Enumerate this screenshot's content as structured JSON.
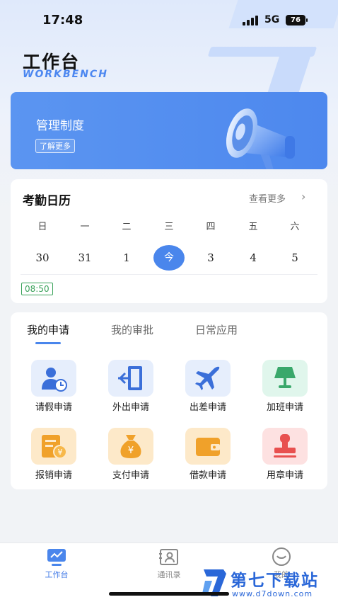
{
  "status_bar": {
    "time": "17:48",
    "network": "5G",
    "battery": "76"
  },
  "header": {
    "title": "工作台",
    "subtitle": "WORKBENCH"
  },
  "banner": {
    "title": "管理制度",
    "button_label": "了解更多",
    "icon": "megaphone-icon"
  },
  "calendar": {
    "title": "考勤日历",
    "more_label": "查看更多",
    "weekdays": [
      "日",
      "一",
      "二",
      "三",
      "四",
      "五",
      "六"
    ],
    "days": [
      "30",
      "31",
      "1",
      "今",
      "3",
      "4",
      "5"
    ],
    "today_index": 3,
    "clock_time": "08:50"
  },
  "apps": {
    "tabs": [
      {
        "label": "我的申请",
        "active": true
      },
      {
        "label": "我的审批",
        "active": false
      },
      {
        "label": "日常应用",
        "active": false
      }
    ],
    "items": [
      {
        "label": "请假申请",
        "icon": "leave-clock-icon",
        "bg": "#e6eefc",
        "color": "#3b6fd9"
      },
      {
        "label": "外出申请",
        "icon": "door-exit-icon",
        "bg": "#e6eefc",
        "color": "#3b6fd9"
      },
      {
        "label": "出差申请",
        "icon": "airplane-icon",
        "bg": "#e6eefc",
        "color": "#3b6fd9"
      },
      {
        "label": "加班申请",
        "icon": "lamp-icon",
        "bg": "#e0f6ec",
        "color": "#3aa86b"
      },
      {
        "label": "报销申请",
        "icon": "receipt-icon",
        "bg": "#fde9c9",
        "color": "#f0a12a"
      },
      {
        "label": "支付申请",
        "icon": "money-bag-icon",
        "bg": "#fde9c9",
        "color": "#f0a12a"
      },
      {
        "label": "借款申请",
        "icon": "wallet-icon",
        "bg": "#fde9c9",
        "color": "#f0a12a"
      },
      {
        "label": "用章申请",
        "icon": "stamp-icon",
        "bg": "#fde1e1",
        "color": "#e8504f"
      }
    ]
  },
  "bottom_nav": [
    {
      "label": "工作台",
      "icon": "dashboard-icon",
      "active": true
    },
    {
      "label": "通讯录",
      "icon": "contacts-icon",
      "active": false
    },
    {
      "label": "我的",
      "icon": "smiley-icon",
      "active": false
    }
  ],
  "watermark": {
    "name": "第七下载站",
    "url": "www.d7down.com"
  }
}
